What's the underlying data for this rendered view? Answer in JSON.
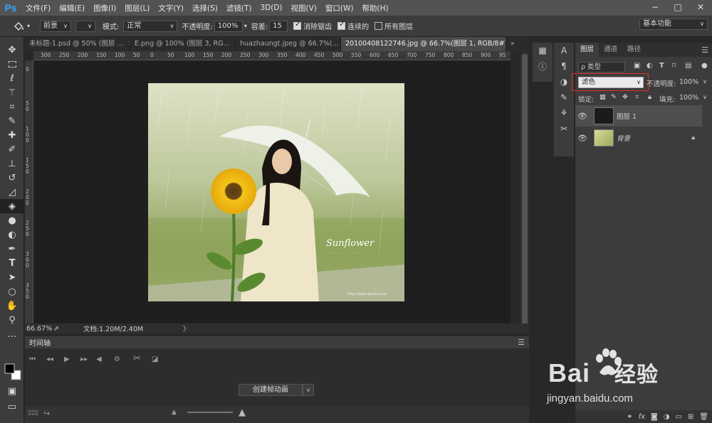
{
  "app": {
    "logo": "Ps"
  },
  "menubar": {
    "items": [
      "文件(F)",
      "编辑(E)",
      "图像(I)",
      "图层(L)",
      "文字(Y)",
      "选择(S)",
      "滤镜(T)",
      "3D(D)",
      "视图(V)",
      "窗口(W)",
      "帮助(H)"
    ],
    "window_controls": [
      "−",
      "□",
      "✕"
    ]
  },
  "optionsbar": {
    "tool_icon": "paint-bucket-icon",
    "fill_source": "前景",
    "mode_label": "模式:",
    "mode_value": "正常",
    "opacity_label": "不透明度:",
    "opacity_value": "100%",
    "tolerance_label": "容差:",
    "tolerance_value": "15",
    "antialias_label": "消除锯齿",
    "contiguous_label": "连续的",
    "all_layers_label": "所有图层",
    "workspace": "基本功能"
  },
  "tabs": [
    {
      "label": "未标题-1.psd @ 50% (图层 ...",
      "close": "×"
    },
    {
      "label": "E.png @ 100% (图层 3, RG...",
      "close": "×"
    },
    {
      "label": "huazhaungt.jpeg @ 66.7%(...",
      "close": "×"
    },
    {
      "label": "20100408122746.jpg @ 66.7%(图层 1, RGB/8#) *",
      "close": "×"
    }
  ],
  "ruler": {
    "h": [
      "300",
      "250",
      "200",
      "150",
      "100",
      "50",
      "0",
      "50",
      "100",
      "150",
      "200",
      "250",
      "300",
      "350",
      "400",
      "450",
      "500",
      "550",
      "600",
      "650",
      "700",
      "750",
      "800",
      "850",
      "900",
      "95"
    ],
    "v": [
      "0",
      "5",
      "0",
      "1",
      "0",
      "0",
      "1",
      "5",
      "0",
      "2",
      "0",
      "0",
      "2",
      "5",
      "0",
      "3",
      "0",
      "0",
      "3",
      "5",
      "0"
    ]
  },
  "status": {
    "zoom": "66.67%",
    "doc": "文档:1.20M/2.40M",
    "arrow": "〉"
  },
  "photo": {
    "caption": "Sunflower",
    "url_text": "http://www.photo.com"
  },
  "timeline": {
    "title": "时间轴",
    "menu": "☰",
    "create_button": "创建帧动画",
    "dropdown": "∨"
  },
  "layers_panel": {
    "tabs": [
      "图层",
      "通道",
      "路径"
    ],
    "filter_label": "ρ 类型",
    "blend_mode": "滤色",
    "opacity_label": "不透明度:",
    "opacity_value": "100%",
    "lock_label": "锁定:",
    "fill_label": "填充:",
    "fill_value": "100%",
    "layers": [
      {
        "name": "图层 1",
        "selected": true,
        "visible": true
      },
      {
        "name": "背景",
        "selected": false,
        "visible": true,
        "locked": true
      }
    ]
  },
  "watermark": {
    "brand": "Bai",
    "brand2": "经验",
    "url": "jingyan.baidu.com"
  },
  "colors": {
    "menubar": "#535353",
    "panel": "#3c3c3c",
    "canvas": "#1f1f1f",
    "highlight_box": "#e0302a",
    "ps_blue": "#31a8ff"
  }
}
